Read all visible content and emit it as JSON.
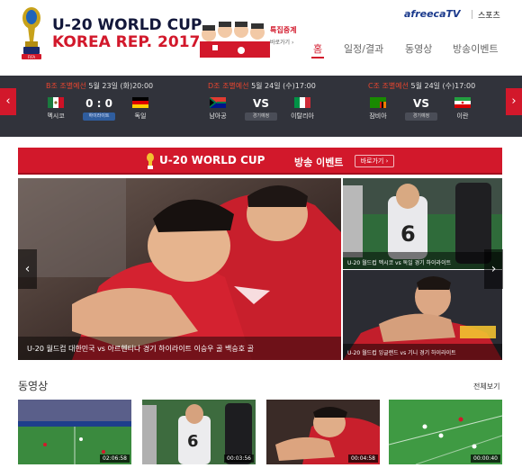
{
  "header": {
    "title_line1": "U-20 WORLD CUP",
    "title_line2": "KOREA REP. 2017",
    "promo_badge": "특집중계",
    "promo_sub": "바로가기 ›",
    "brand": "afreecaTV",
    "brand_section": "스포츠",
    "nav": [
      {
        "label": "홈",
        "active": true
      },
      {
        "label": "일정/결과",
        "active": false
      },
      {
        "label": "동영상",
        "active": false
      },
      {
        "label": "방송이벤트",
        "active": false
      }
    ]
  },
  "schedule": {
    "prev_label": "‹",
    "next_label": "›",
    "matches": [
      {
        "group": "B조 조별예선",
        "date": "5월 23일 (화)20:00",
        "home": "멕시코",
        "away": "독일",
        "center": "0 : 0",
        "status": "하이라이트",
        "status_type": "live"
      },
      {
        "group": "D조 조별예선",
        "date": "5월 24일 (수)17:00",
        "home": "남아공",
        "away": "이탈리아",
        "center": "VS",
        "status": "경기예정",
        "status_type": "pending"
      },
      {
        "group": "C조 조별예선",
        "date": "5월 24일 (수)17:00",
        "home": "잠비아",
        "away": "이란",
        "center": "VS",
        "status": "경기예정",
        "status_type": "pending"
      }
    ]
  },
  "banner": {
    "title": "U-20 WORLD CUP",
    "event": "방송 이벤트",
    "button": "바로가기 ›"
  },
  "slider": {
    "prev_label": "‹",
    "next_label": "›",
    "hero_caption": "U-20 월드컵 대한민국 vs 아르헨티나 경기 하이라이트 이승우 골 백승호 골",
    "side_captions": [
      "U-20 월드컵 멕시코 vs 독일 경기 하이라이트",
      "U-20 월드컵 잉글랜드 vs 기니 경기 하이라이트"
    ]
  },
  "videos": {
    "title": "동영상",
    "more": "전체보기",
    "items": [
      {
        "duration": "02:06:58"
      },
      {
        "duration": "00:03:56"
      },
      {
        "duration": "00:04:58"
      },
      {
        "duration": "00:00:40"
      }
    ]
  },
  "colors": {
    "accent_red": "#d2182b",
    "navy": "#12173a",
    "strip_bg": "#31333b"
  }
}
